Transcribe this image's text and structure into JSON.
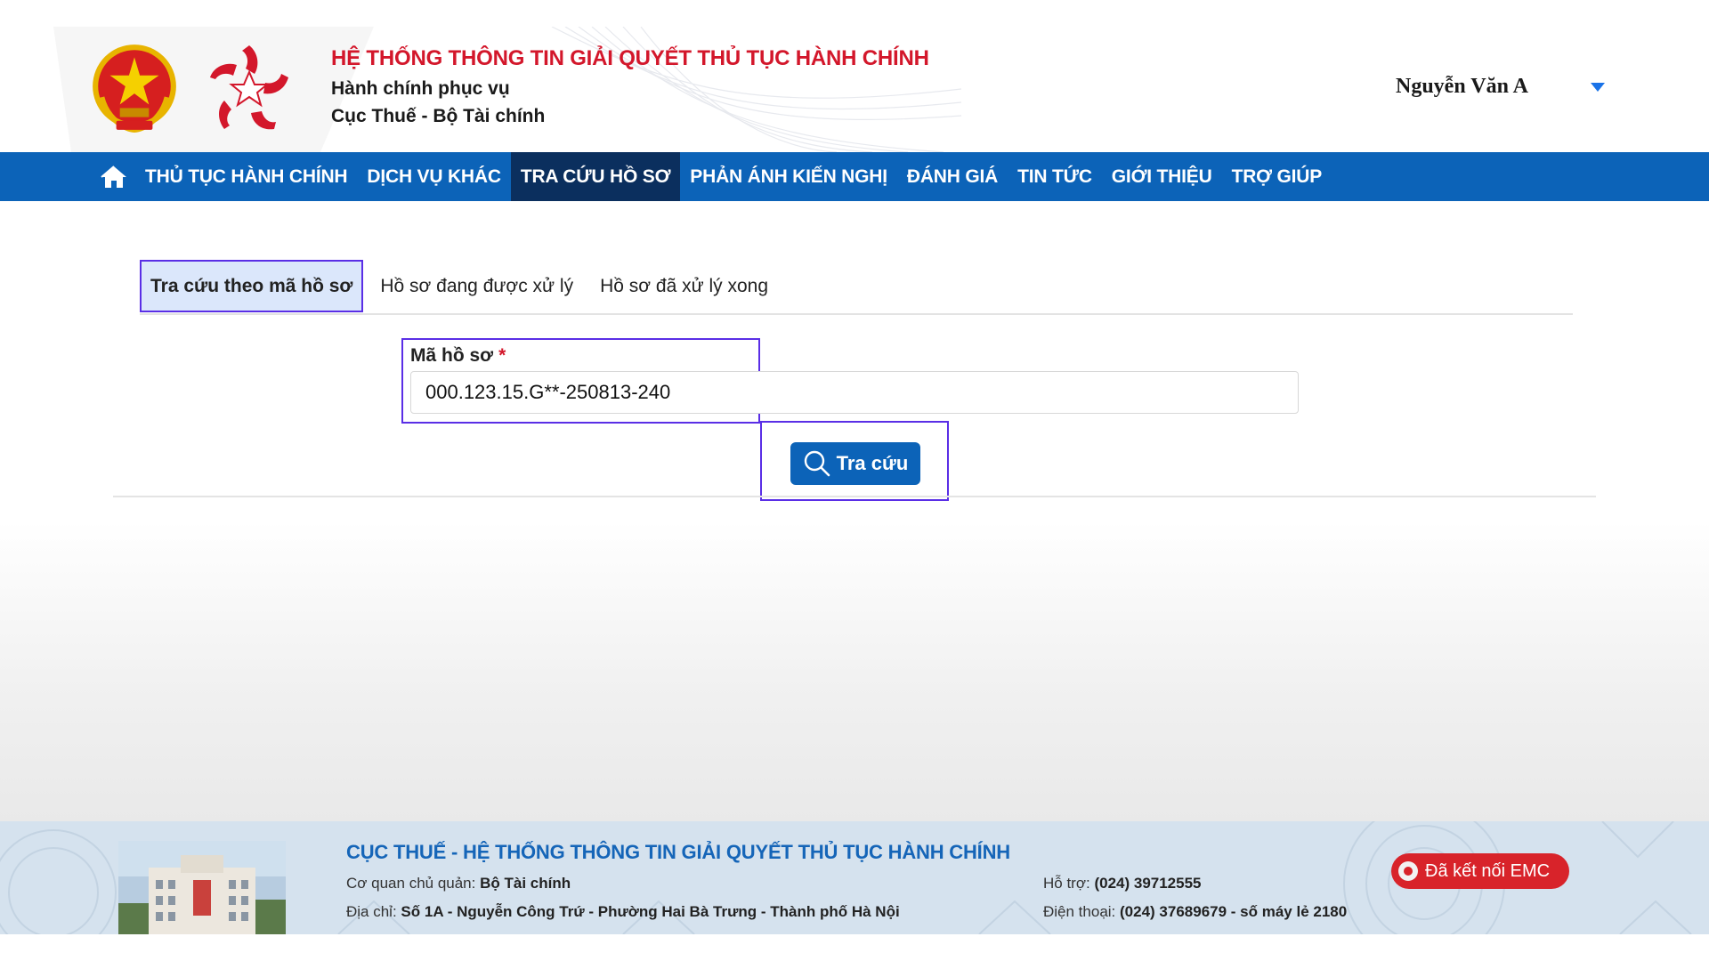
{
  "header": {
    "system_title": "HỆ THỐNG THÔNG TIN GIẢI QUYẾT THỦ TỤC HÀNH CHÍNH",
    "subtitle_1": "Hành chính phục vụ",
    "subtitle_2": "Cục Thuế - Bộ Tài chính",
    "user_name": "Nguyễn Văn A"
  },
  "nav": {
    "items": [
      {
        "label": "THỦ TỤC HÀNH CHÍNH"
      },
      {
        "label": "DỊCH VỤ KHÁC"
      },
      {
        "label": "TRA CỨU HỒ SƠ",
        "active": true
      },
      {
        "label": "PHẢN ÁNH KIẾN NGHỊ"
      },
      {
        "label": "ĐÁNH GIÁ"
      },
      {
        "label": "TIN TỨC"
      },
      {
        "label": "GIỚI THIỆU"
      },
      {
        "label": "TRỢ GIÚP"
      }
    ]
  },
  "tabs": [
    {
      "label": "Tra cứu theo mã hồ sơ",
      "active": true
    },
    {
      "label": "Hồ sơ đang được xử lý"
    },
    {
      "label": "Hồ sơ đã xử lý xong"
    }
  ],
  "form": {
    "field_label": "Mã hồ sơ",
    "required_mark": "*",
    "field_value": "000.123.15.G**-250813-240",
    "search_button": "Tra cứu"
  },
  "footer": {
    "title": "CỤC THUẾ - HỆ THỐNG THÔNG TIN GIẢI QUYẾT THỦ TỤC HÀNH CHÍNH",
    "agency_label": "Cơ quan chủ quản:",
    "agency_value": "Bộ Tài chính",
    "address_label": "Địa chỉ:",
    "address_value": "Số 1A - Nguyễn Công Trứ - Phường Hai Bà Trưng - Thành phố Hà Nội",
    "support_label": "Hỗ trợ:",
    "support_value": "(024) 39712555",
    "phone_label": "Điện thoại:",
    "phone_value": "(024) 37689679 - số máy lẻ 2180",
    "emc_badge": "Đã kết nối EMC"
  },
  "colors": {
    "brand_red": "#d3172b",
    "nav_blue": "#0c63b8",
    "nav_active": "#0b2f5e",
    "highlight_purple": "#5a2ee6"
  },
  "icons": [
    "national-emblem-icon",
    "admin-service-star-logo",
    "home-icon",
    "search-icon",
    "chevron-down-icon",
    "emc-icon"
  ]
}
